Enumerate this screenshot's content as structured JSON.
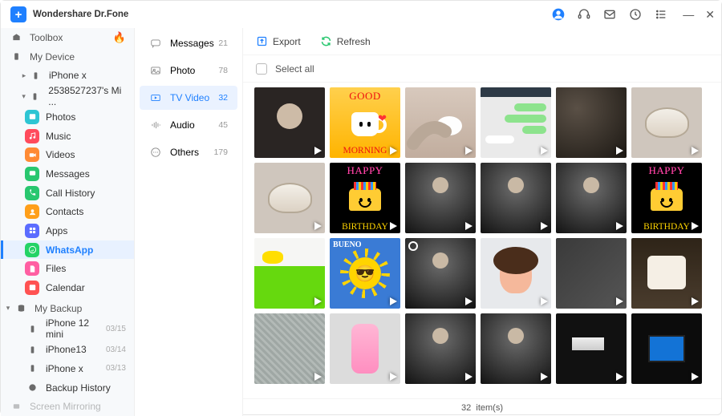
{
  "app": {
    "title": "Wondershare Dr.Fone"
  },
  "sidebar1": {
    "toolbox": "Toolbox",
    "myDevice": "My Device",
    "iphonex": "iPhone x",
    "mi": "2538527237's Mi ...",
    "items": {
      "photos": "Photos",
      "music": "Music",
      "videos": "Videos",
      "messages": "Messages",
      "callhistory": "Call History",
      "contacts": "Contacts",
      "apps": "Apps",
      "whatsapp": "WhatsApp",
      "files": "Files",
      "calendar": "Calendar"
    },
    "myBackup": "My Backup",
    "backups": [
      {
        "name": "iPhone 12 mini",
        "date": "03/15"
      },
      {
        "name": "iPhone13",
        "date": "03/14"
      },
      {
        "name": "iPhone x",
        "date": "03/13"
      }
    ],
    "backupHistory": "Backup History",
    "screenMirroring": "Screen Mirroring"
  },
  "sidebar2": {
    "items": [
      {
        "key": "messages",
        "label": "Messages",
        "count": "21"
      },
      {
        "key": "photo",
        "label": "Photo",
        "count": "78"
      },
      {
        "key": "tvvideo",
        "label": "TV Video",
        "count": "32",
        "selected": true
      },
      {
        "key": "audio",
        "label": "Audio",
        "count": "45"
      },
      {
        "key": "others",
        "label": "Others",
        "count": "179"
      }
    ]
  },
  "toolbar": {
    "export": "Export",
    "refresh": "Refresh"
  },
  "selectAll": "Select all",
  "status": {
    "count": "32",
    "label": "item(s)"
  },
  "thumbs": {
    "goodmorning_top": "GOOD",
    "goodmorning_bot": "MORNING",
    "happy": "HAPPY",
    "birthday": "BIRTHDAY",
    "bueno": "BUENO"
  }
}
